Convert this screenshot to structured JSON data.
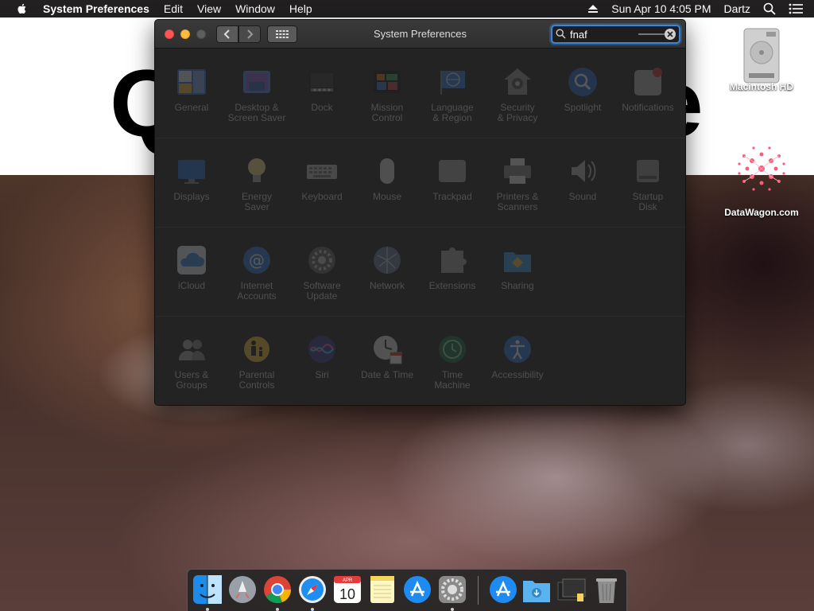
{
  "menubar": {
    "app_name": "System Preferences",
    "menus": [
      "Edit",
      "View",
      "Window",
      "Help"
    ],
    "date_time": "Sun Apr 10  4:05 PM",
    "user": "Dartz"
  },
  "window": {
    "title": "System Preferences",
    "search_value": "fnaf",
    "prefs": [
      "General",
      "Desktop &\nScreen Saver",
      "Dock",
      "Mission\nControl",
      "Language\n& Region",
      "Security\n& Privacy",
      "Spotlight",
      "Notifications",
      "Displays",
      "Energy\nSaver",
      "Keyboard",
      "Mouse",
      "Trackpad",
      "Printers &\nScanners",
      "Sound",
      "Startup\nDisk",
      "iCloud",
      "Internet\nAccounts",
      "Software\nUpdate",
      "Network",
      "Extensions",
      "Sharing",
      "Users &\nGroups",
      "Parental\nControls",
      "Siri",
      "Date & Time",
      "Time\nMachine",
      "Accessibility"
    ]
  },
  "desktop": {
    "icons": [
      {
        "label": "Macintosh HD"
      },
      {
        "label": "DataWagon.com"
      }
    ],
    "wallpaper_letters": [
      "Q",
      "e"
    ]
  },
  "dock": {
    "apps": [
      "Finder",
      "Launchpad",
      "Chrome",
      "Safari",
      "Calendar",
      "Notes",
      "App Store",
      "System Preferences",
      "App Store",
      "Downloads",
      "Folder",
      "Trash"
    ],
    "calendar_month": "APR",
    "calendar_day": "10"
  },
  "colors": {
    "accent": "#3b84d8",
    "close": "#fc5753",
    "minimize": "#fdbc40",
    "zoom": "#5e5e5e"
  }
}
